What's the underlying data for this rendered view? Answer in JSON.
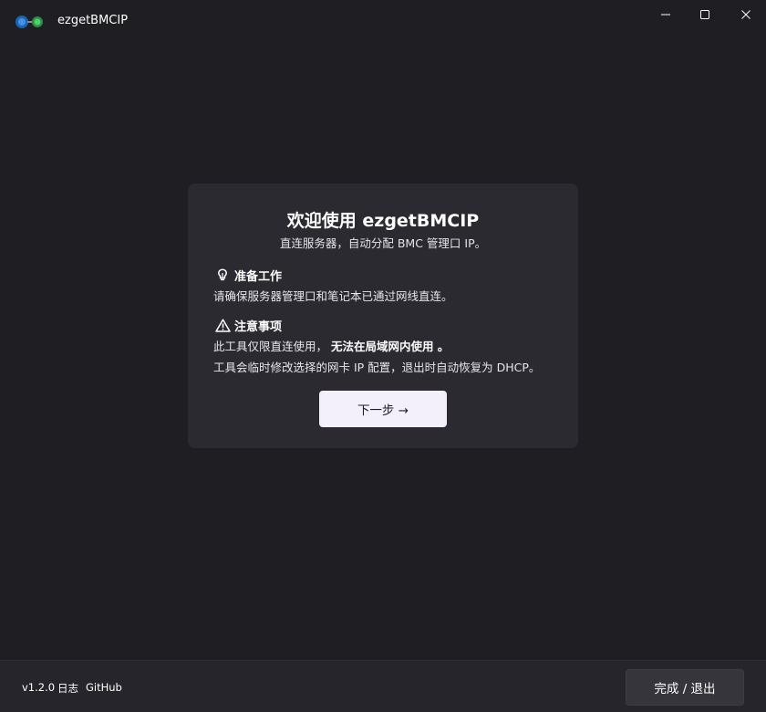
{
  "titlebar": {
    "app_title": "ezgetBMCIP",
    "logo_icon": "link-nodes-icon",
    "minimize_icon": "minimize-icon",
    "maximize_icon": "maximize-icon",
    "close_icon": "close-icon"
  },
  "card": {
    "title": "欢迎使用 ezgetBMCIP",
    "subtitle": "直连服务器，自动分配 BMC 管理口 IP。",
    "prep": {
      "icon": "lightbulb-icon",
      "heading": "准备工作",
      "text": "请确保服务器管理口和笔记本已通过网线直连。"
    },
    "notice": {
      "icon": "warning-icon",
      "heading": "注意事项",
      "line1_prefix": "此工具仅限直连使用，",
      "line1_strong": "无法在局域网内使用 。",
      "line2": "工具会临时修改选择的网卡 IP 配置，退出时自动恢复为 DHCP。"
    },
    "next_button": "下一步 →"
  },
  "footer": {
    "version": "v1.2.0",
    "log_link": "日志",
    "github_link": "GitHub",
    "finish_button": "完成 / 退出"
  },
  "colors": {
    "background": "#1f1e23",
    "card": "#2b2a30",
    "primary_button": "#f3f0fb",
    "logo_blue": "#2f7fd6",
    "logo_green": "#3cbf5a"
  }
}
